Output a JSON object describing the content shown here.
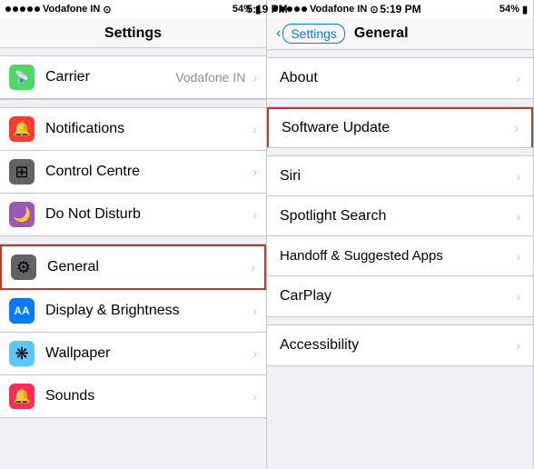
{
  "left_panel": {
    "status": {
      "carrier": "Vodafone IN",
      "time": "5:19 PM",
      "battery": "54%"
    },
    "header": "Settings",
    "sections": [
      {
        "items": [
          {
            "id": "carrier",
            "label": "Carrier",
            "subtext": "Vodafone IN",
            "icon": "📡",
            "icon_color": "icon-green",
            "show_arrow": true,
            "highlighted": false
          }
        ]
      },
      {
        "items": [
          {
            "id": "notifications",
            "label": "Notifications",
            "icon": "🔔",
            "icon_color": "icon-red",
            "show_arrow": true,
            "highlighted": false
          },
          {
            "id": "control-centre",
            "label": "Control Centre",
            "icon": "⊞",
            "icon_color": "icon-dark",
            "show_arrow": true,
            "highlighted": false
          },
          {
            "id": "do-not-disturb",
            "label": "Do Not Disturb",
            "icon": "🌙",
            "icon_color": "icon-purple",
            "show_arrow": true,
            "highlighted": false
          }
        ]
      },
      {
        "items": [
          {
            "id": "general",
            "label": "General",
            "icon": "⚙",
            "icon_color": "icon-dark",
            "show_arrow": true,
            "highlighted": true
          },
          {
            "id": "display-brightness",
            "label": "Display & Brightness",
            "icon": "AA",
            "icon_color": "icon-blue",
            "show_arrow": true,
            "highlighted": false
          },
          {
            "id": "wallpaper",
            "label": "Wallpaper",
            "icon": "❋",
            "icon_color": "icon-teal",
            "show_arrow": true,
            "highlighted": false
          },
          {
            "id": "sounds",
            "label": "Sounds",
            "icon": "🔔",
            "icon_color": "icon-pink",
            "show_arrow": true,
            "highlighted": false
          }
        ]
      }
    ]
  },
  "right_panel": {
    "status": {
      "carrier": "Vodafone IN",
      "time": "5:19 PM",
      "battery": "54%"
    },
    "back_label": "Settings",
    "header": "General",
    "sections": [
      {
        "items": [
          {
            "id": "about",
            "label": "About",
            "show_arrow": true,
            "highlighted": false
          }
        ]
      },
      {
        "items": [
          {
            "id": "software-update",
            "label": "Software Update",
            "show_arrow": true,
            "highlighted": true
          }
        ]
      },
      {
        "items": [
          {
            "id": "siri",
            "label": "Siri",
            "show_arrow": true,
            "highlighted": false
          },
          {
            "id": "spotlight-search",
            "label": "Spotlight Search",
            "show_arrow": true,
            "highlighted": false
          },
          {
            "id": "handoff",
            "label": "Handoff & Suggested Apps",
            "show_arrow": true,
            "highlighted": false
          },
          {
            "id": "carplay",
            "label": "CarPlay",
            "show_arrow": true,
            "highlighted": false
          }
        ]
      },
      {
        "items": [
          {
            "id": "accessibility",
            "label": "Accessibility",
            "show_arrow": true,
            "highlighted": false
          }
        ]
      }
    ]
  }
}
